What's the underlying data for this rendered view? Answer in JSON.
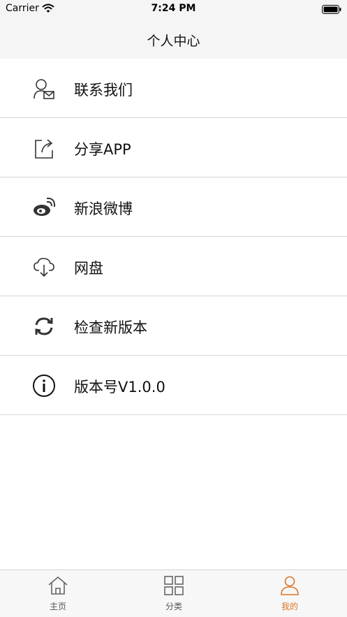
{
  "status_bar": {
    "carrier": "Carrier",
    "time": "7:24 PM",
    "wifi_icon": "wifi-icon",
    "battery_icon": "battery-icon"
  },
  "nav": {
    "title": "个人中心"
  },
  "menu": {
    "items": [
      {
        "label": "联系我们",
        "icon": "contact-user-mail-icon"
      },
      {
        "label": "分享APP",
        "icon": "share-icon"
      },
      {
        "label": "新浪微博",
        "icon": "weibo-icon"
      },
      {
        "label": "网盘",
        "icon": "cloud-download-icon"
      },
      {
        "label": "检查新版本",
        "icon": "refresh-icon"
      },
      {
        "label": "版本号V1.0.0",
        "icon": "info-icon"
      }
    ]
  },
  "tab_bar": {
    "tabs": [
      {
        "label": "主页",
        "icon": "home-icon",
        "active": false
      },
      {
        "label": "分类",
        "icon": "grid-icon",
        "active": false
      },
      {
        "label": "我的",
        "icon": "person-icon",
        "active": true
      }
    ]
  },
  "colors": {
    "accent": "#d9772b",
    "nav_background": "#f5f5f5",
    "divider": "#d6d6d6",
    "icon": "#333333"
  }
}
